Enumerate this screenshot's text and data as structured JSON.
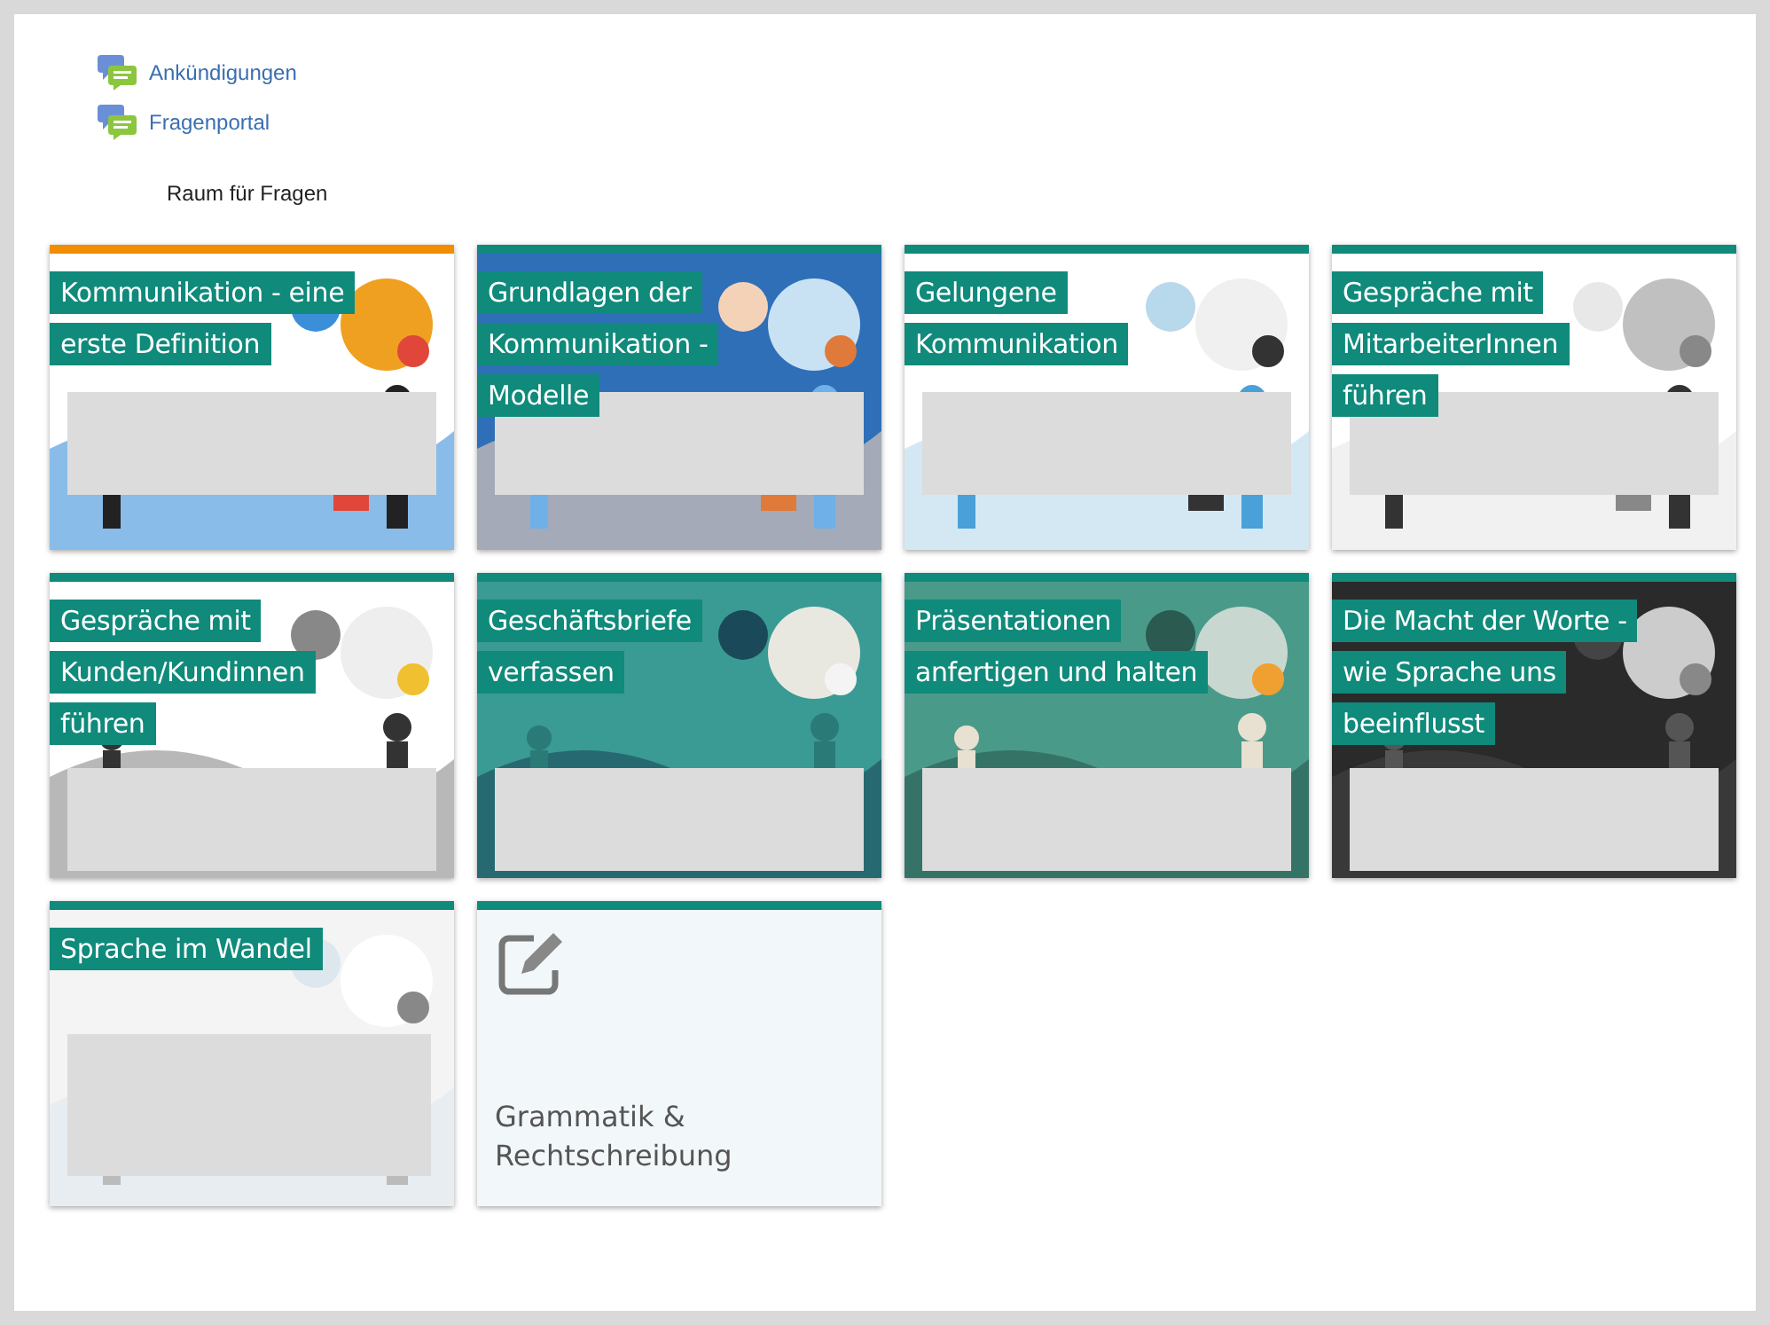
{
  "links": [
    {
      "label": "Ankündigungen"
    },
    {
      "label": "Fragenportal",
      "description": "Raum für Fragen"
    }
  ],
  "tiles": [
    {
      "kind": "picture",
      "title_lines": [
        "Kommunikation - eine",
        "erste Definition"
      ],
      "selected": true
    },
    {
      "kind": "picture",
      "title_lines": [
        "Grundlagen der",
        "Kommunikation -",
        "Modelle"
      ],
      "selected": false
    },
    {
      "kind": "picture",
      "title_lines": [
        "Gelungene",
        "Kommunikation"
      ],
      "selected": false
    },
    {
      "kind": "picture",
      "title_lines": [
        "Gespräche mit",
        "MitarbeiterInnen",
        "führen"
      ],
      "selected": false
    },
    {
      "kind": "picture",
      "title_lines": [
        "Gespräche mit",
        "Kunden/Kundinnen",
        "führen"
      ],
      "selected": false
    },
    {
      "kind": "picture",
      "title_lines": [
        "Geschäftsbriefe",
        "verfassen"
      ],
      "selected": false
    },
    {
      "kind": "picture",
      "title_lines": [
        "Präsentationen",
        "anfertigen und halten"
      ],
      "selected": false
    },
    {
      "kind": "picture",
      "title_lines": [
        "Die Macht der Worte -",
        "wie Sprache uns",
        "beeinflusst"
      ],
      "selected": false
    },
    {
      "kind": "picture",
      "title_lines": [
        "Sprache im Wandel"
      ],
      "selected": false
    },
    {
      "kind": "activity",
      "title_lines": [
        "Grammatik &",
        "Rechtschreibung"
      ],
      "selected": false
    }
  ]
}
